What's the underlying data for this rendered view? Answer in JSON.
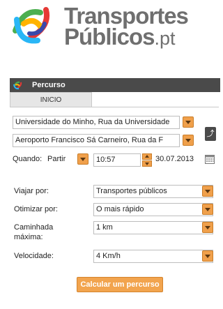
{
  "brand": {
    "line1": "Transportes",
    "line2": "Públicos",
    "suffix": ".pt"
  },
  "panel": {
    "title": "Percurso",
    "tab": "INICIO"
  },
  "route": {
    "origin": "Universidade do Minho, Rua da Universidade",
    "destination": "Aeroporto Francisco Sá Carneiro, Rua da F"
  },
  "when": {
    "label": "Quando:",
    "mode": "Partir",
    "time": "10:57",
    "date": "30.07.2013"
  },
  "options": {
    "viajar_label": "Viajar por:",
    "viajar_value": "Transportes públicos",
    "otimizar_label": "Otimizar por:",
    "otimizar_value": "O mais rápido",
    "caminhada_label_1": "Caminhada",
    "caminhada_label_2": "máxima:",
    "caminhada_value": "1 km",
    "velocidade_label": "Velocidade:",
    "velocidade_value": "4 Km/h"
  },
  "actions": {
    "calculate": "Calcular um percurso",
    "swap_glyph": "⤴"
  },
  "colors": {
    "accent": "#f0a04b",
    "header": "#4a4a4a",
    "brand_gray": "#6f6f6f"
  }
}
